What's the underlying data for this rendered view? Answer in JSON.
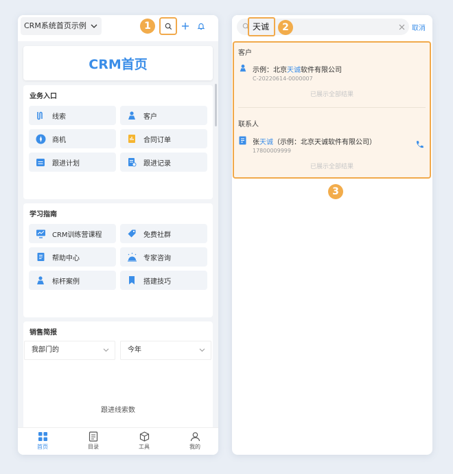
{
  "left": {
    "space_name": "CRM系统首页示例",
    "banner": "CRM首页",
    "sections": [
      {
        "title": "业务入口",
        "items": [
          {
            "label": "线索",
            "icon": "funnel-icon"
          },
          {
            "label": "客户",
            "icon": "person-icon"
          },
          {
            "label": "商机",
            "icon": "compass-icon"
          },
          {
            "label": "合同订单",
            "icon": "contract-icon"
          },
          {
            "label": "跟进计划",
            "icon": "calendar-icon"
          },
          {
            "label": "跟进记录",
            "icon": "record-icon"
          }
        ]
      },
      {
        "title": "学习指南",
        "items": [
          {
            "label": "CRM训练营课程",
            "icon": "monitor-icon"
          },
          {
            "label": "免费社群",
            "icon": "tag-icon"
          },
          {
            "label": "帮助中心",
            "icon": "document-icon"
          },
          {
            "label": "专家咨询",
            "icon": "expert-icon"
          },
          {
            "label": "标杆案例",
            "icon": "person-icon"
          },
          {
            "label": "搭建技巧",
            "icon": "bookmark-icon"
          }
        ]
      }
    ],
    "report": {
      "title": "销售简报",
      "dept_select": "我部门的",
      "period_select": "今年",
      "metric_label": "跟进线索数"
    },
    "tabs": [
      {
        "label": "首页",
        "icon": "grid-icon",
        "active": true
      },
      {
        "label": "目录",
        "icon": "catalog-icon",
        "active": false
      },
      {
        "label": "工具",
        "icon": "cube-icon",
        "active": false
      },
      {
        "label": "我的",
        "icon": "user-icon",
        "active": false
      }
    ]
  },
  "right": {
    "query": "天诚",
    "cancel": "取消",
    "customer_section": {
      "title": "客户",
      "name_prefix": "示例：北京",
      "name_highlight": "天诚",
      "name_suffix": "软件有限公司",
      "code": "C-20220614-0000007",
      "all_shown": "已展示全部结果"
    },
    "contact_section": {
      "title": "联系人",
      "name_prefix": "张",
      "name_highlight": "天诚",
      "name_suffix": "（示例：北京天诚软件有限公司）",
      "phone": "17800009999",
      "all_shown": "已展示全部结果"
    }
  },
  "annotations": {
    "step1": "1",
    "step2": "2",
    "step3": "3"
  },
  "colors": {
    "accent": "#3b8ee8",
    "highlight_border": "#f1a94b",
    "badge": "#f2ac4b",
    "result_bg": "#fdf4ea"
  }
}
